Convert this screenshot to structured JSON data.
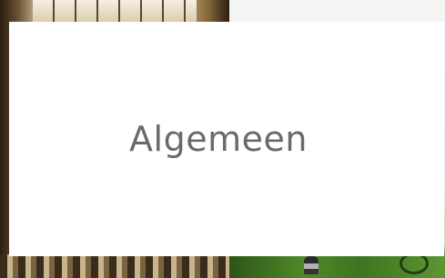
{
  "tile": {
    "title": "Algemeen"
  },
  "colors": {
    "card_background": "#ffffff",
    "title_text": "#6a6a6a"
  }
}
